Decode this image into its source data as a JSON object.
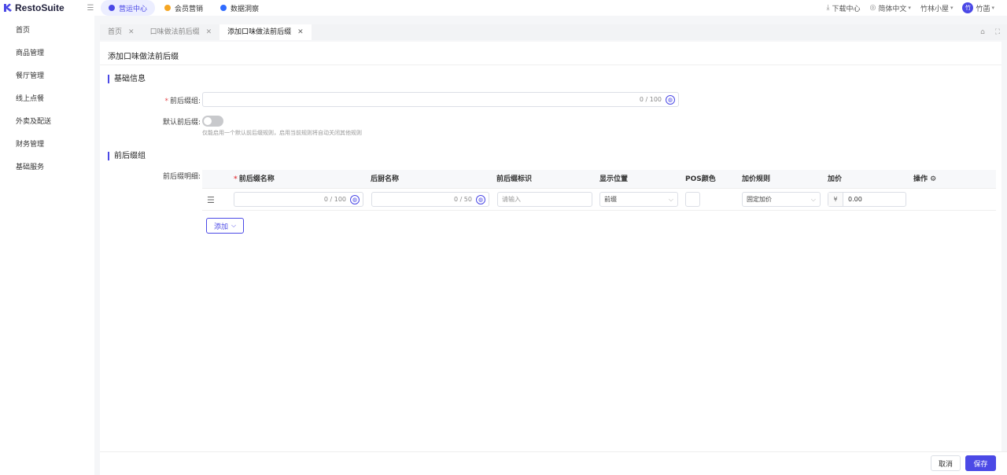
{
  "brand": {
    "name": "RestoSuite",
    "accent": "#4b49e6"
  },
  "top_nav": {
    "tabs": [
      {
        "label": "营运中心",
        "active": true,
        "dot_color": "#4b49e6"
      },
      {
        "label": "会员营销",
        "active": false,
        "dot_color": "#f5a623"
      },
      {
        "label": "数据洞察",
        "active": false,
        "dot_color": "#2f6bff"
      }
    ],
    "download": "下载中心",
    "language": "简体中文",
    "store": "竹林小屋",
    "user": "竹菡",
    "avatar_text": "竹"
  },
  "sidebar": {
    "items": [
      {
        "label": "首页"
      },
      {
        "label": "商品管理"
      },
      {
        "label": "餐厅管理"
      },
      {
        "label": "线上点餐"
      },
      {
        "label": "外卖及配送"
      },
      {
        "label": "财务管理"
      },
      {
        "label": "基础服务"
      }
    ]
  },
  "tabs": [
    {
      "label": "首页",
      "active": false
    },
    {
      "label": "口味做法前后缀",
      "active": false
    },
    {
      "label": "添加口味做法前后缀",
      "active": true
    }
  ],
  "page": {
    "title": "添加口味做法前后缀",
    "basic_section": "基础信息",
    "group_label": "前后缀组:",
    "group_counter": "0 / 100",
    "default_label": "默认前后缀:",
    "default_on": false,
    "default_hint": "仅能启用一个默认前后缀规则，启用当前规则将自动关闭其他规则",
    "group_section": "前后缀组",
    "detail_label": "前后缀明细:"
  },
  "table": {
    "columns": [
      "前后缀名称",
      "后厨名称",
      "前后缀标识",
      "显示位置",
      "POS颜色",
      "加价规则",
      "加价",
      "操作"
    ],
    "rows": [
      {
        "name_counter": "0 / 100",
        "kitchen_counter": "0 / 50",
        "identifier_placeholder": "请输入",
        "position": "前缀",
        "price_rule": "固定加价",
        "currency": "¥",
        "price": "0.00"
      }
    ]
  },
  "buttons": {
    "add": "添加",
    "cancel": "取消",
    "save": "保存"
  }
}
